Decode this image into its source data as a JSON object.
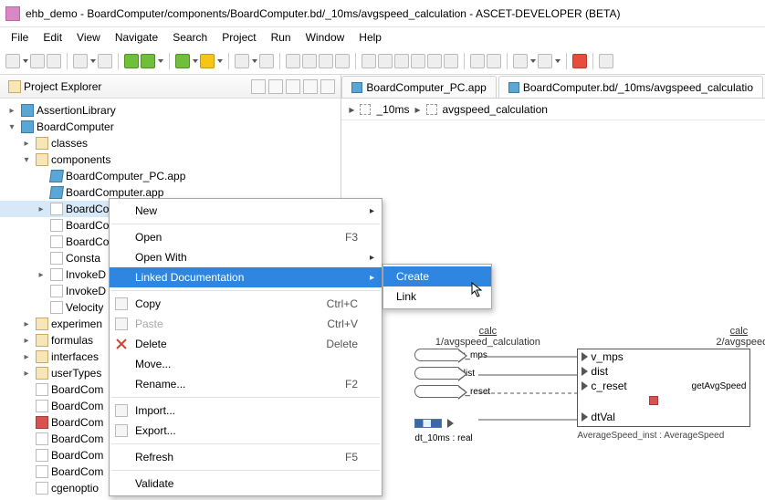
{
  "window": {
    "title": "ehb_demo - BoardComputer/components/BoardComputer.bd/_10ms/avgspeed_calculation - ASCET-DEVELOPER (BETA)"
  },
  "menu": [
    "File",
    "Edit",
    "View",
    "Navigate",
    "Search",
    "Project",
    "Run",
    "Window",
    "Help"
  ],
  "explorer": {
    "title": "Project Explorer",
    "items": [
      {
        "indent": 0,
        "tw": ">",
        "icon": "prj",
        "label": "AssertionLibrary"
      },
      {
        "indent": 0,
        "tw": "v",
        "icon": "prj",
        "label": "BoardComputer"
      },
      {
        "indent": 1,
        "tw": ">",
        "icon": "pkg",
        "label": "classes"
      },
      {
        "indent": 1,
        "tw": "v",
        "icon": "pkg",
        "label": "components"
      },
      {
        "indent": 2,
        "tw": "",
        "icon": "app",
        "label": "BoardComputer_PC.app"
      },
      {
        "indent": 2,
        "tw": "",
        "icon": "app",
        "label": "BoardComputer.app"
      },
      {
        "indent": 2,
        "tw": ">",
        "icon": "file",
        "label": "BoardCo",
        "sel": true
      },
      {
        "indent": 2,
        "tw": "",
        "icon": "file",
        "label": "BoardCo"
      },
      {
        "indent": 2,
        "tw": "",
        "icon": "file",
        "label": "BoardCo"
      },
      {
        "indent": 2,
        "tw": "",
        "icon": "file",
        "label": "Consta"
      },
      {
        "indent": 2,
        "tw": ">",
        "icon": "file",
        "label": "InvokeD"
      },
      {
        "indent": 2,
        "tw": "",
        "icon": "file",
        "label": "InvokeD"
      },
      {
        "indent": 2,
        "tw": "",
        "icon": "file",
        "label": "Velocity"
      },
      {
        "indent": 1,
        "tw": ">",
        "icon": "pkg",
        "label": "experimen"
      },
      {
        "indent": 1,
        "tw": ">",
        "icon": "pkg",
        "label": "formulas"
      },
      {
        "indent": 1,
        "tw": ">",
        "icon": "pkg",
        "label": "interfaces"
      },
      {
        "indent": 1,
        "tw": ">",
        "icon": "pkg",
        "label": "userTypes"
      },
      {
        "indent": 1,
        "tw": "",
        "icon": "file",
        "label": "BoardCom"
      },
      {
        "indent": 1,
        "tw": "",
        "icon": "file",
        "label": "BoardCom"
      },
      {
        "indent": 1,
        "tw": "",
        "icon": "red",
        "label": "BoardCom"
      },
      {
        "indent": 1,
        "tw": "",
        "icon": "file",
        "label": "BoardCom"
      },
      {
        "indent": 1,
        "tw": "",
        "icon": "file",
        "label": "BoardCom"
      },
      {
        "indent": 1,
        "tw": "",
        "icon": "file",
        "label": "BoardCom"
      },
      {
        "indent": 1,
        "tw": "",
        "icon": "file",
        "label": "cgenoptio"
      }
    ]
  },
  "tabs": [
    {
      "label": "BoardComputer_PC.app",
      "active": false
    },
    {
      "label": "BoardComputer.bd/_10ms/avgspeed_calculatio",
      "active": true
    }
  ],
  "breadcrumb": {
    "item1": "_10ms",
    "item2": "avgspeed_calculation"
  },
  "ctx": {
    "items": [
      {
        "type": "item",
        "label": "New",
        "sub": ">"
      },
      {
        "type": "sep"
      },
      {
        "type": "item",
        "label": "Open",
        "shortcut": "F3"
      },
      {
        "type": "item",
        "label": "Open With",
        "sub": ">"
      },
      {
        "type": "item",
        "label": "Linked Documentation",
        "sub": ">",
        "hi": true
      },
      {
        "type": "sep"
      },
      {
        "type": "item",
        "label": "Copy",
        "icon": "copy",
        "shortcut": "Ctrl+C"
      },
      {
        "type": "item",
        "label": "Paste",
        "icon": "paste",
        "shortcut": "Ctrl+V",
        "dis": true
      },
      {
        "type": "item",
        "label": "Delete",
        "icon": "redx",
        "shortcut": "Delete"
      },
      {
        "type": "item",
        "label": "Move..."
      },
      {
        "type": "item",
        "label": "Rename...",
        "shortcut": "F2"
      },
      {
        "type": "sep"
      },
      {
        "type": "item",
        "label": "Import...",
        "icon": "import"
      },
      {
        "type": "item",
        "label": "Export...",
        "icon": "export"
      },
      {
        "type": "sep"
      },
      {
        "type": "item",
        "label": "Refresh",
        "shortcut": "F5"
      },
      {
        "type": "sep"
      },
      {
        "type": "item",
        "label": "Validate"
      }
    ],
    "submenu": [
      {
        "label": "Create",
        "hi": true
      },
      {
        "label": "Link"
      }
    ]
  },
  "diagram": {
    "block1": {
      "title": "calc",
      "subtitle": "1/avgspeed_calculation",
      "ports": [
        "v_mps",
        "dist",
        "c_reset"
      ],
      "dtlabel": "dt_10ms : real"
    },
    "block2": {
      "title": "calc",
      "subtitle": "2/avgspeed",
      "rows": [
        "v_mps",
        "dist",
        "c_reset",
        "dtVal"
      ],
      "rlabel": "getAvgSpeed",
      "footer": "AverageSpeed_inst : AverageSpeed"
    }
  }
}
